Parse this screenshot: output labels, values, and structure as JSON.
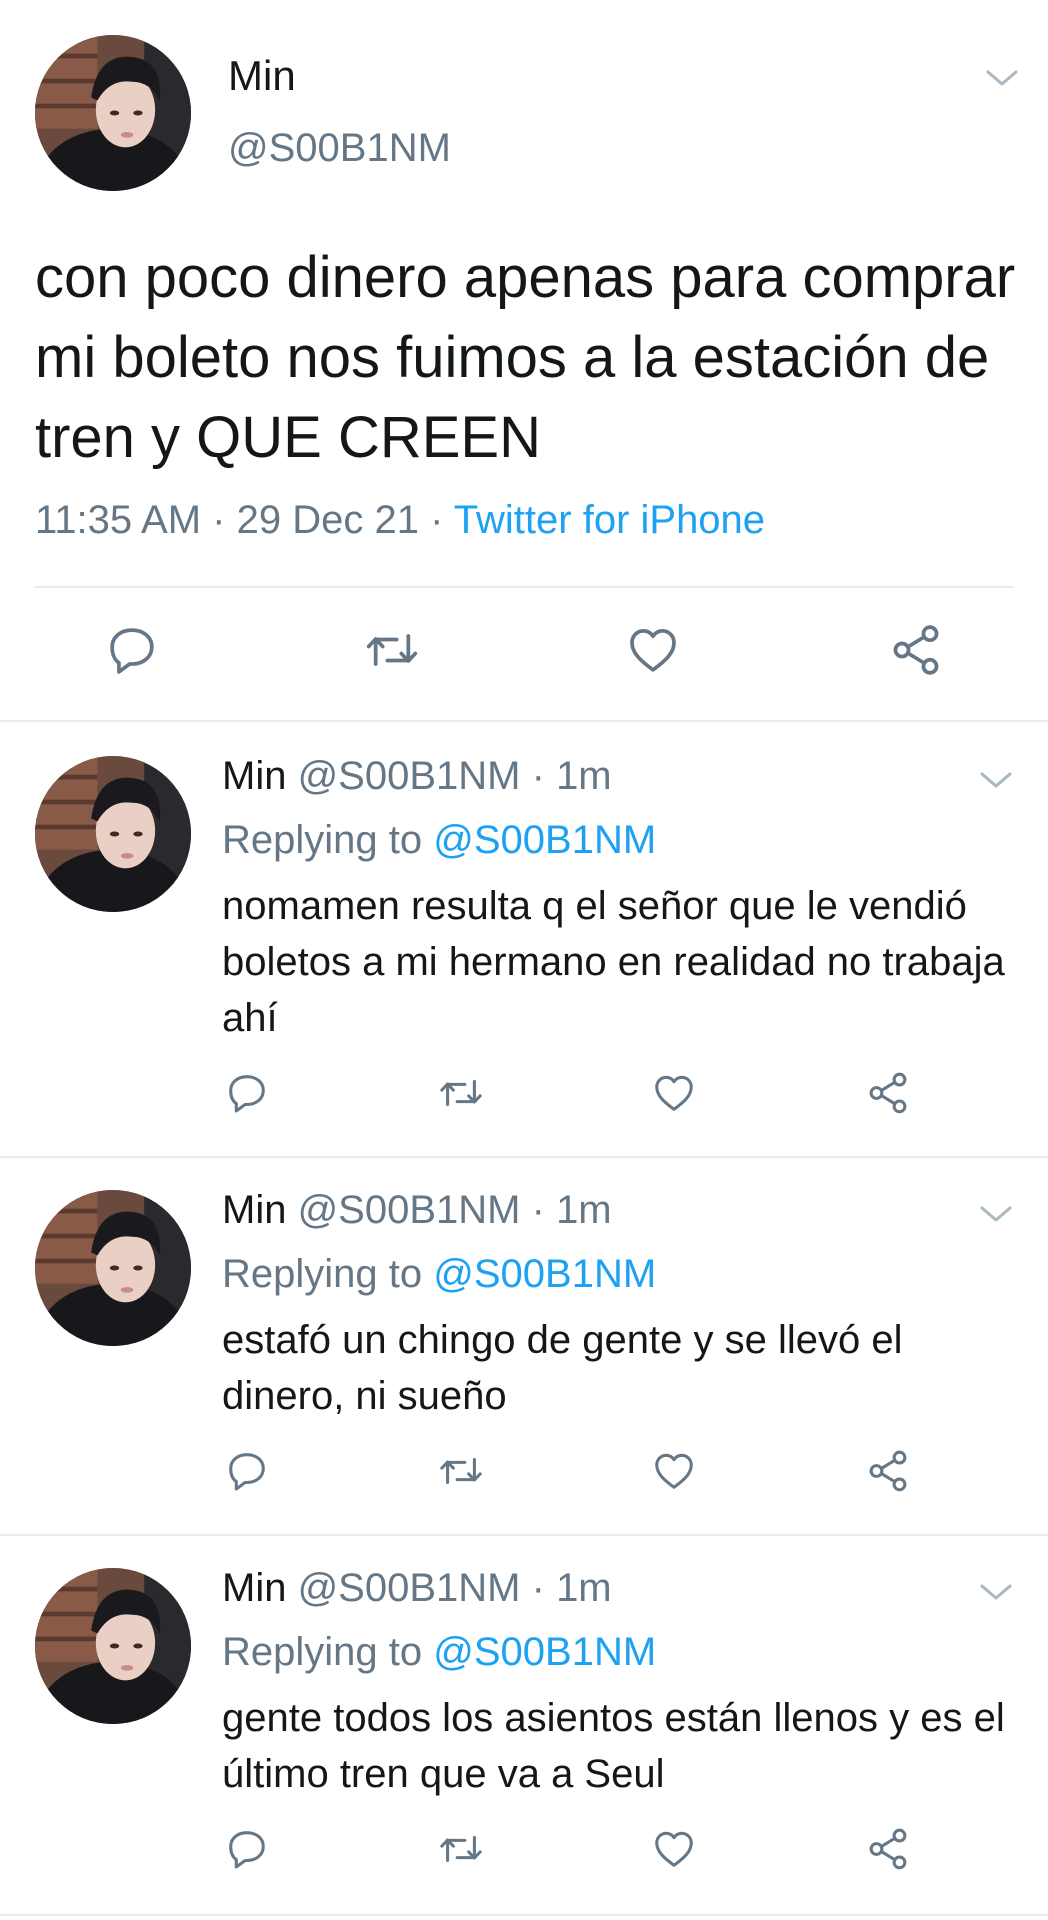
{
  "main_tweet": {
    "name": "Min",
    "handle": "@S00B1NM",
    "text": "con poco dinero apenas para comprar mi boleto nos fuimos a la estación de tren y QUE CREEN",
    "time": "11:35 AM",
    "date": "29 Dec 21",
    "source": "Twitter for iPhone"
  },
  "replies": [
    {
      "name": "Min",
      "handle": "@S00B1NM",
      "time": "1m",
      "replying_label": "Replying to",
      "replying_to": "@S00B1NM",
      "text": "nomamen resulta q el señor que le vendió boletos a mi hermano en realidad no trabaja ahí"
    },
    {
      "name": "Min",
      "handle": "@S00B1NM",
      "time": "1m",
      "replying_label": "Replying to",
      "replying_to": "@S00B1NM",
      "text": "estafó un chingo de gente y se llevó el dinero, ni sueño"
    },
    {
      "name": "Min",
      "handle": "@S00B1NM",
      "time": "1m",
      "replying_label": "Replying to",
      "replying_to": "@S00B1NM",
      "text": "gente todos los asientos están llenos y es el último tren que va a Seul"
    }
  ],
  "icons": [
    "reply-icon",
    "retweet-icon",
    "like-icon",
    "share-icon",
    "chevron-down-icon"
  ],
  "colors": {
    "link": "#1da1f2",
    "secondary_text": "#657786",
    "primary_text": "#14171a",
    "divider": "#e6ecf0"
  }
}
